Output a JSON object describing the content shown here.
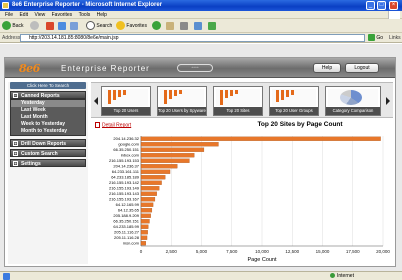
{
  "window": {
    "title": "8e6 Enterprise Reporter - Microsoft Internet Explorer",
    "min": "_",
    "max": "□",
    "close": "×"
  },
  "menu": [
    "File",
    "Edit",
    "View",
    "Favorites",
    "Tools",
    "Help"
  ],
  "toolbar": {
    "back": "Back",
    "search": "Search",
    "favorites": "Favorites"
  },
  "address": {
    "label": "Address",
    "url": "http://203.14.181.85:8080/8e6e/main.jsp",
    "go": "Go",
    "links": "Links"
  },
  "app": {
    "logo": "8e6",
    "title": "Enterprise Reporter",
    "help": "Help",
    "logout": "Logout"
  },
  "sidebar": {
    "click_here": "Click Here To Search",
    "canned_reports": "Canned Reports",
    "canned_items": [
      "Yesterday",
      "Last Week",
      "Last Month",
      "Week to Yesterday",
      "Month to Yesterday"
    ],
    "drill_down": "Drill Down Reports",
    "custom_search": "Custom Search",
    "settings": "Settings"
  },
  "thumbnails": [
    "Top 20 Users",
    "Top 20 Users by Spyware",
    "Top 20 Sites",
    "Top 20 User Groups",
    "Category Comparison"
  ],
  "report": {
    "detail_link": "Detail Report"
  },
  "statusbar": {
    "zone": "Internet"
  },
  "chart_data": {
    "type": "bar",
    "orientation": "horizontal",
    "title": "Top 20 Sites by Page Count",
    "xlabel": "Page Count",
    "ylabel": "",
    "xlim": [
      0,
      20000
    ],
    "xticks": [
      "0",
      "2,500",
      "5,000",
      "7,500",
      "10,000",
      "12,500",
      "15,000",
      "17,500",
      "20,000"
    ],
    "categories": [
      "204.14.236.32",
      "google.com",
      "66.35.250.151",
      "inbox.com",
      "216.155.193.153",
      "204.14.236.37",
      "64.233.161.111",
      "64.233.185.189",
      "216.155.193.142",
      "216.155.193.149",
      "216.155.193.143",
      "216.155.193.167",
      "64.12.165.99",
      "64.12.35.65",
      "205.188.9.209",
      "66.35.250.151",
      "64.233.185.99",
      "205.11.116.27",
      "205.11.116.28",
      "msn.com"
    ],
    "values": [
      19800,
      6400,
      5200,
      4400,
      4000,
      3000,
      2400,
      2000,
      1700,
      1500,
      1300,
      1150,
      1000,
      900,
      800,
      700,
      600,
      550,
      500,
      400
    ],
    "bar_color": "#e8772a"
  }
}
